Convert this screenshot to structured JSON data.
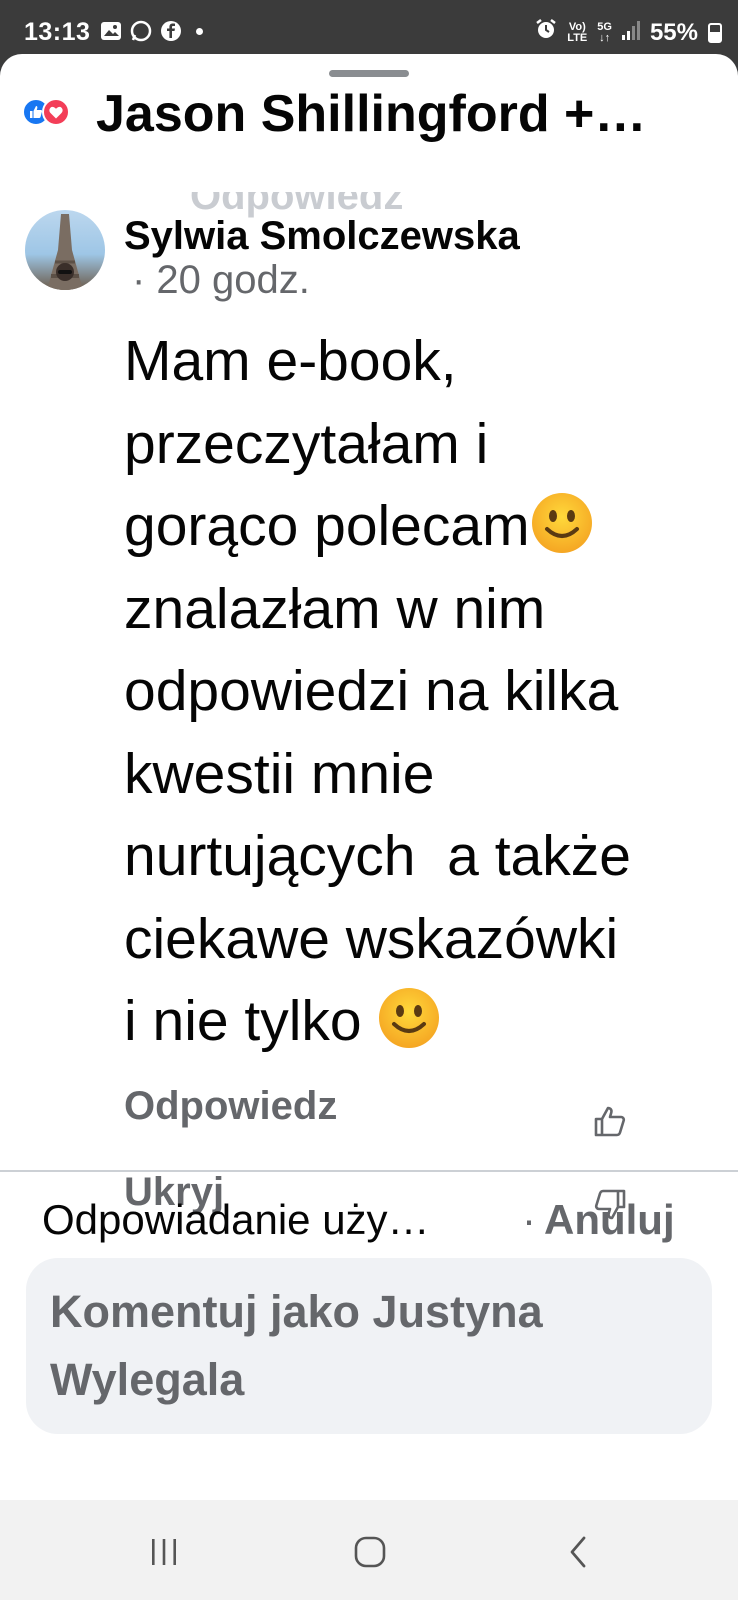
{
  "status_bar": {
    "time": "13:13",
    "volte": "Vo)",
    "lte": "LTE",
    "network": "5G",
    "battery": "55%"
  },
  "sheet": {
    "title": "Jason Shillingford +…",
    "obscured_text": "Odpowiedz"
  },
  "comment": {
    "author": "Sylwia Smolczewska",
    "time": "· 20 godz.",
    "lines": [
      "Mam e-book,",
      "przeczytałam i",
      "gorąco polecam",
      "znalazłam w nim",
      "odpowiedzi na kilka",
      "kwestii mnie",
      "nurtujących  a także",
      "ciekawe wskazówki",
      "i nie tylko "
    ],
    "reply_label": "Odpowiedz",
    "hide_label": "Ukryj"
  },
  "reply_bar": {
    "replying_text": "Odpowiadanie uży…",
    "separator": "·",
    "cancel_label": "Anuluj",
    "composer_placeholder": "Komentuj jako Justyna Wylegala"
  },
  "colors": {
    "status_bar": "#3b3b3b",
    "secondary_text": "#65676b",
    "like_blue": "#1877f2",
    "love_red": "#f33e58",
    "composer_bg": "#f0f2f5"
  }
}
